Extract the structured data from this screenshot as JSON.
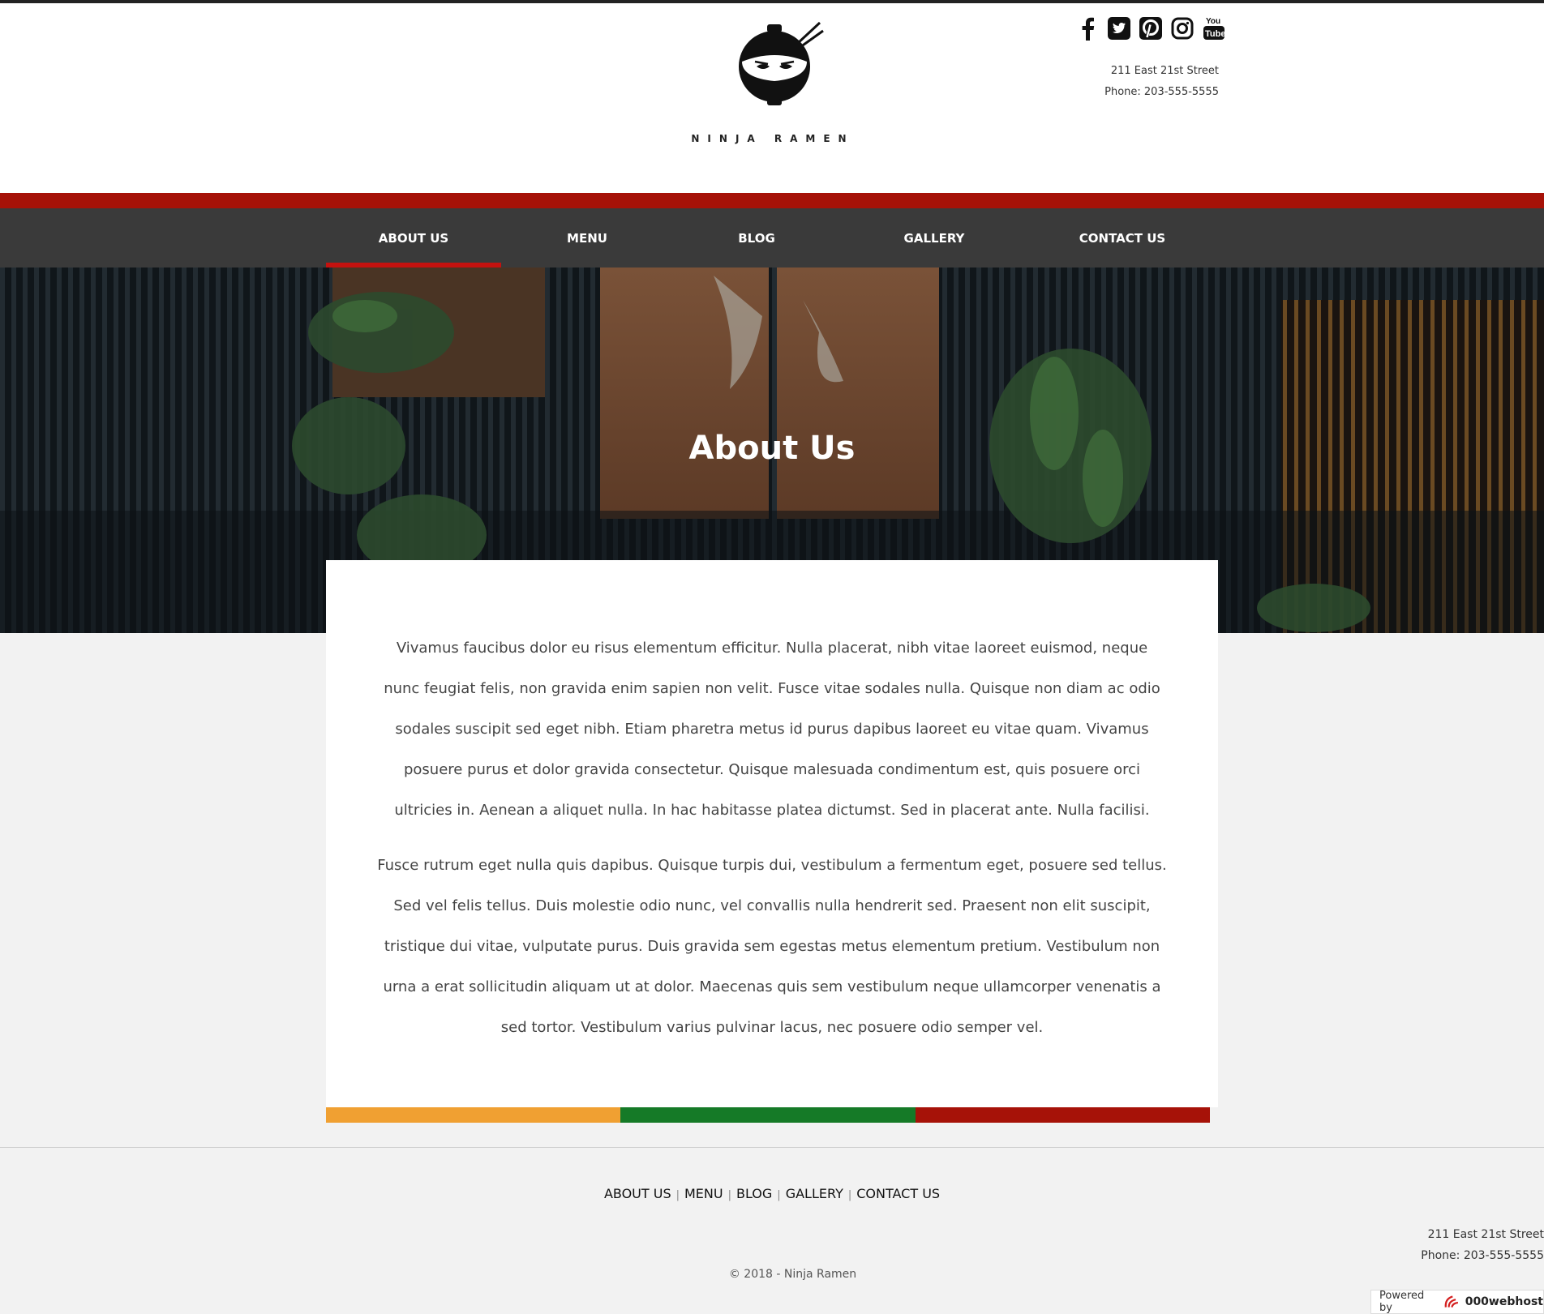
{
  "brand": {
    "name": "NINJA RAMEN"
  },
  "social": [
    "facebook-icon",
    "twitter-icon",
    "pinterest-icon",
    "instagram-icon",
    "youtube-icon"
  ],
  "contact": {
    "street": "211 East 21st Street",
    "phone": "Phone: 203-555-5555"
  },
  "nav": {
    "items": [
      "ABOUT US",
      "MENU",
      "BLOG",
      "GALLERY",
      "CONTACT US"
    ],
    "active": "ABOUT US"
  },
  "hero": {
    "title": "About Us"
  },
  "content": {
    "paragraphs": [
      "Vivamus faucibus dolor eu risus elementum efficitur. Nulla placerat, nibh vitae laoreet euismod, neque nunc feugiat felis, non gravida enim sapien non velit. Fusce vitae sodales nulla. Quisque non diam ac odio sodales suscipit sed eget nibh. Etiam pharetra metus id purus dapibus laoreet eu vitae quam. Vivamus posuere purus et dolor gravida consectetur. Quisque malesuada condimentum est, quis posuere orci ultricies in. Aenean a aliquet nulla. In hac habitasse platea dictumst. Sed in placerat ante. Nulla facilisi.",
      "Fusce rutrum eget nulla quis dapibus. Quisque turpis dui, vestibulum a fermentum eget, posuere sed tellus. Sed vel felis tellus. Duis molestie odio nunc, vel convallis nulla hendrerit sed. Praesent non elit suscipit, tristique dui vitae, vulputate purus. Duis gravida sem egestas metus elementum pretium. Vestibulum non urna a erat sollicitudin aliquam ut at dolor. Maecenas quis sem vestibulum neque ullamcorper venenatis a sed tortor. Vestibulum varius pulvinar lacus, nec posuere odio semper vel."
    ]
  },
  "colors": {
    "red": "#a61208",
    "nav_bg": "#3a3a3a",
    "orange": "#f0a032",
    "green": "#157a27",
    "dark_red": "#a61208"
  },
  "footer": {
    "nav": [
      "ABOUT US",
      "MENU",
      "BLOG",
      "GALLERY",
      "CONTACT US"
    ],
    "copyright": "© 2018 - Ninja Ramen"
  },
  "powered": {
    "label": "Powered by",
    "host": "000webhost"
  }
}
